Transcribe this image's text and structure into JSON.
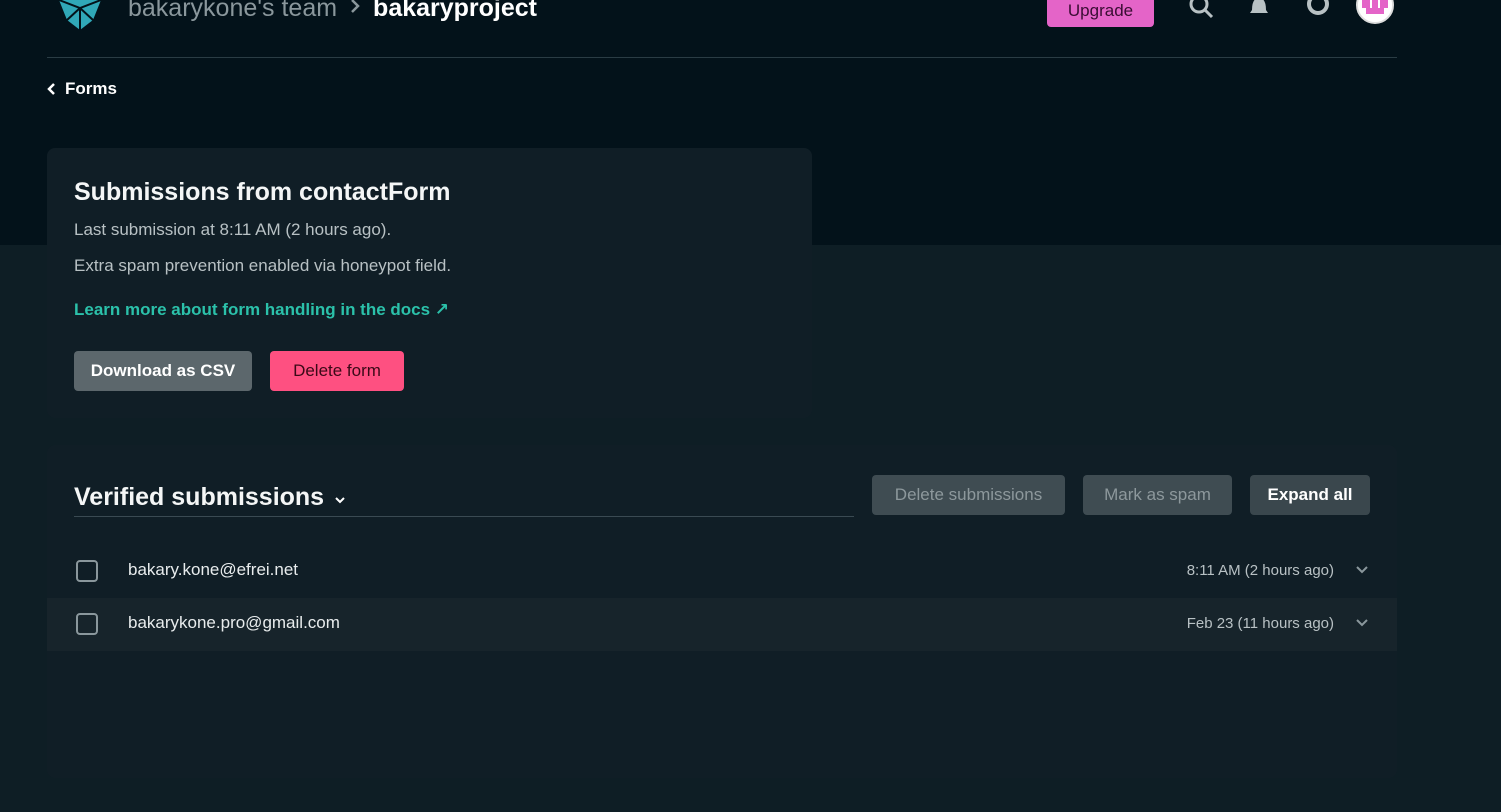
{
  "header": {
    "team": "bakarykone's team",
    "project": "bakaryproject",
    "upgrade_label": "Upgrade"
  },
  "back_link": {
    "label": "Forms"
  },
  "form_info": {
    "title": "Submissions from contactForm",
    "last_submission": "Last submission at 8:11 AM (2 hours ago).",
    "spam_note": "Extra spam prevention enabled via honeypot field.",
    "docs_link": "Learn more about form handling in the docs ↗",
    "download_label": "Download as CSV",
    "delete_form_label": "Delete form"
  },
  "submissions": {
    "filter_label": "Verified submissions",
    "delete_label": "Delete submissions",
    "spam_label": "Mark as spam",
    "expand_label": "Expand all",
    "rows": [
      {
        "email": "bakary.kone@efrei.net",
        "time": "8:11 AM (2 hours ago)"
      },
      {
        "email": "bakarykone.pro@gmail.com",
        "time": "Feb 23 (11 hours ago)"
      }
    ]
  },
  "colors": {
    "accent_teal": "#2bc1aa",
    "upgrade_pink": "#e464c8",
    "danger_pink": "#fe5081"
  }
}
